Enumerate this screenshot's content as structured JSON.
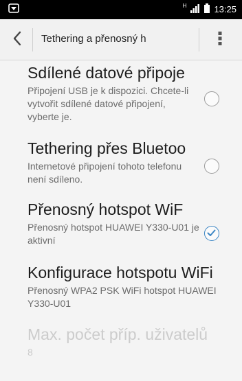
{
  "status_bar": {
    "net_label": "H",
    "time": "13:25",
    "left_icon": "notification-icon",
    "signal_icon": "signal-icon",
    "battery_icon": "battery-icon"
  },
  "action_bar": {
    "title": "Tethering a přenosný h",
    "back_icon": "chevron-left-icon",
    "overflow_icon": "more-vert-icon"
  },
  "items": [
    {
      "title": "Sdílené datové připoje",
      "summary": "Připojení USB je k dispozici. Chcete-li vytvořit sdílené datové připojení, vyberte je.",
      "checked": false
    },
    {
      "title": "Tethering přes Bluetoo",
      "summary": "Internetové připojení tohoto telefonu není sdíleno.",
      "checked": false
    },
    {
      "title": "Přenosný hotspot WiF",
      "summary": "Přenosný hotspot HUAWEI Y330-U01 je aktivní",
      "checked": true
    },
    {
      "title": "Konfigurace hotspotu WiFi",
      "summary": "Přenosný WPA2 PSK WiFi hotspot HUAWEI Y330-U01"
    },
    {
      "title": "Max. počet příp. uživatelů",
      "summary": "8",
      "disabled": true
    }
  ],
  "colors": {
    "status_bar_bg": "#000000",
    "background": "#f4f4f4",
    "checkbox_accent": "#3c86c4",
    "disabled_text": "#cccccc"
  }
}
